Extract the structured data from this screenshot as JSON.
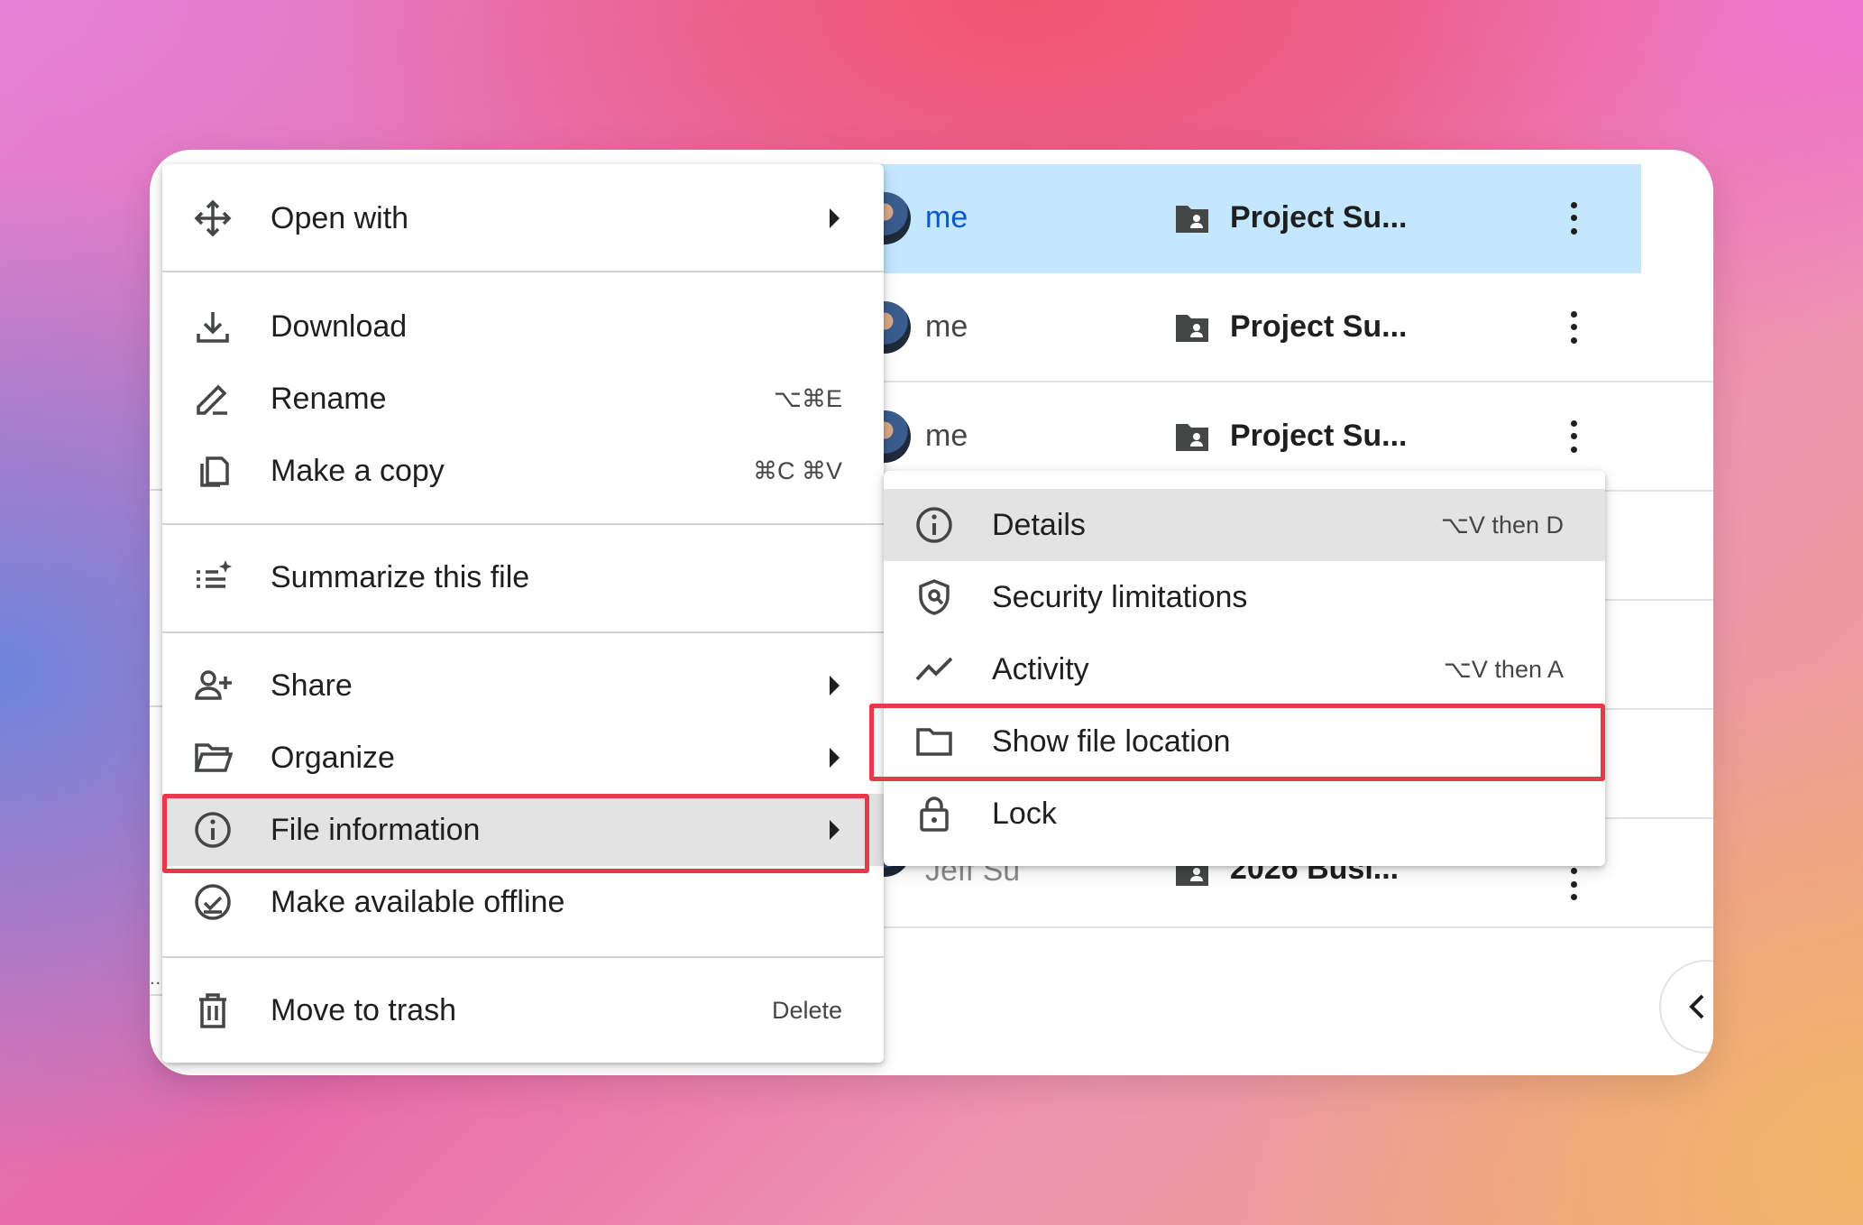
{
  "background": {
    "accent_colors": [
      "#f2546e",
      "#6d84dc",
      "#f2b468",
      "#ef73cf"
    ]
  },
  "file_list": {
    "rows": [
      {
        "owner": "me",
        "location": "Project Su...",
        "selected": true
      },
      {
        "owner": "me",
        "location": "Project Su...",
        "selected": false
      },
      {
        "owner": "me",
        "location": "Project Su...",
        "selected": false
      },
      {
        "owner": "",
        "location": "",
        "selected": false
      },
      {
        "owner": "",
        "location": "",
        "selected": false
      },
      {
        "owner": "",
        "location": "",
        "selected": false
      },
      {
        "owner": "Jeff Su",
        "location": "2026 Busi...",
        "selected": false
      }
    ],
    "stray_text": ".."
  },
  "context_menu": {
    "items": [
      {
        "label": "Open with",
        "icon": "open-with-icon",
        "submenu": true
      },
      {
        "label": "Download",
        "icon": "download-icon"
      },
      {
        "label": "Rename",
        "icon": "rename-icon",
        "shortcut": "⌥⌘E"
      },
      {
        "label": "Make a copy",
        "icon": "copy-icon",
        "shortcut": "⌘C ⌘V"
      },
      {
        "label": "Summarize this file",
        "icon": "summarize-icon"
      },
      {
        "label": "Share",
        "icon": "share-icon",
        "submenu": true
      },
      {
        "label": "Organize",
        "icon": "organize-folder-icon",
        "submenu": true
      },
      {
        "label": "File information",
        "icon": "info-icon",
        "submenu": true,
        "highlighted": true
      },
      {
        "label": "Make available offline",
        "icon": "offline-check-icon"
      },
      {
        "label": "Move to trash",
        "icon": "trash-icon",
        "shortcut": "Delete"
      }
    ]
  },
  "submenu": {
    "items": [
      {
        "label": "Details",
        "icon": "info-icon",
        "shortcut": "⌥V then D",
        "highlighted": true
      },
      {
        "label": "Security limitations",
        "icon": "shield-icon"
      },
      {
        "label": "Activity",
        "icon": "activity-icon",
        "shortcut": "⌥V then A"
      },
      {
        "label": "Show file location",
        "icon": "folder-icon",
        "annotated": true
      },
      {
        "label": "Lock",
        "icon": "lock-icon"
      }
    ]
  },
  "annotation_color": "#e8394a",
  "selection_color": "#c2e7ff"
}
